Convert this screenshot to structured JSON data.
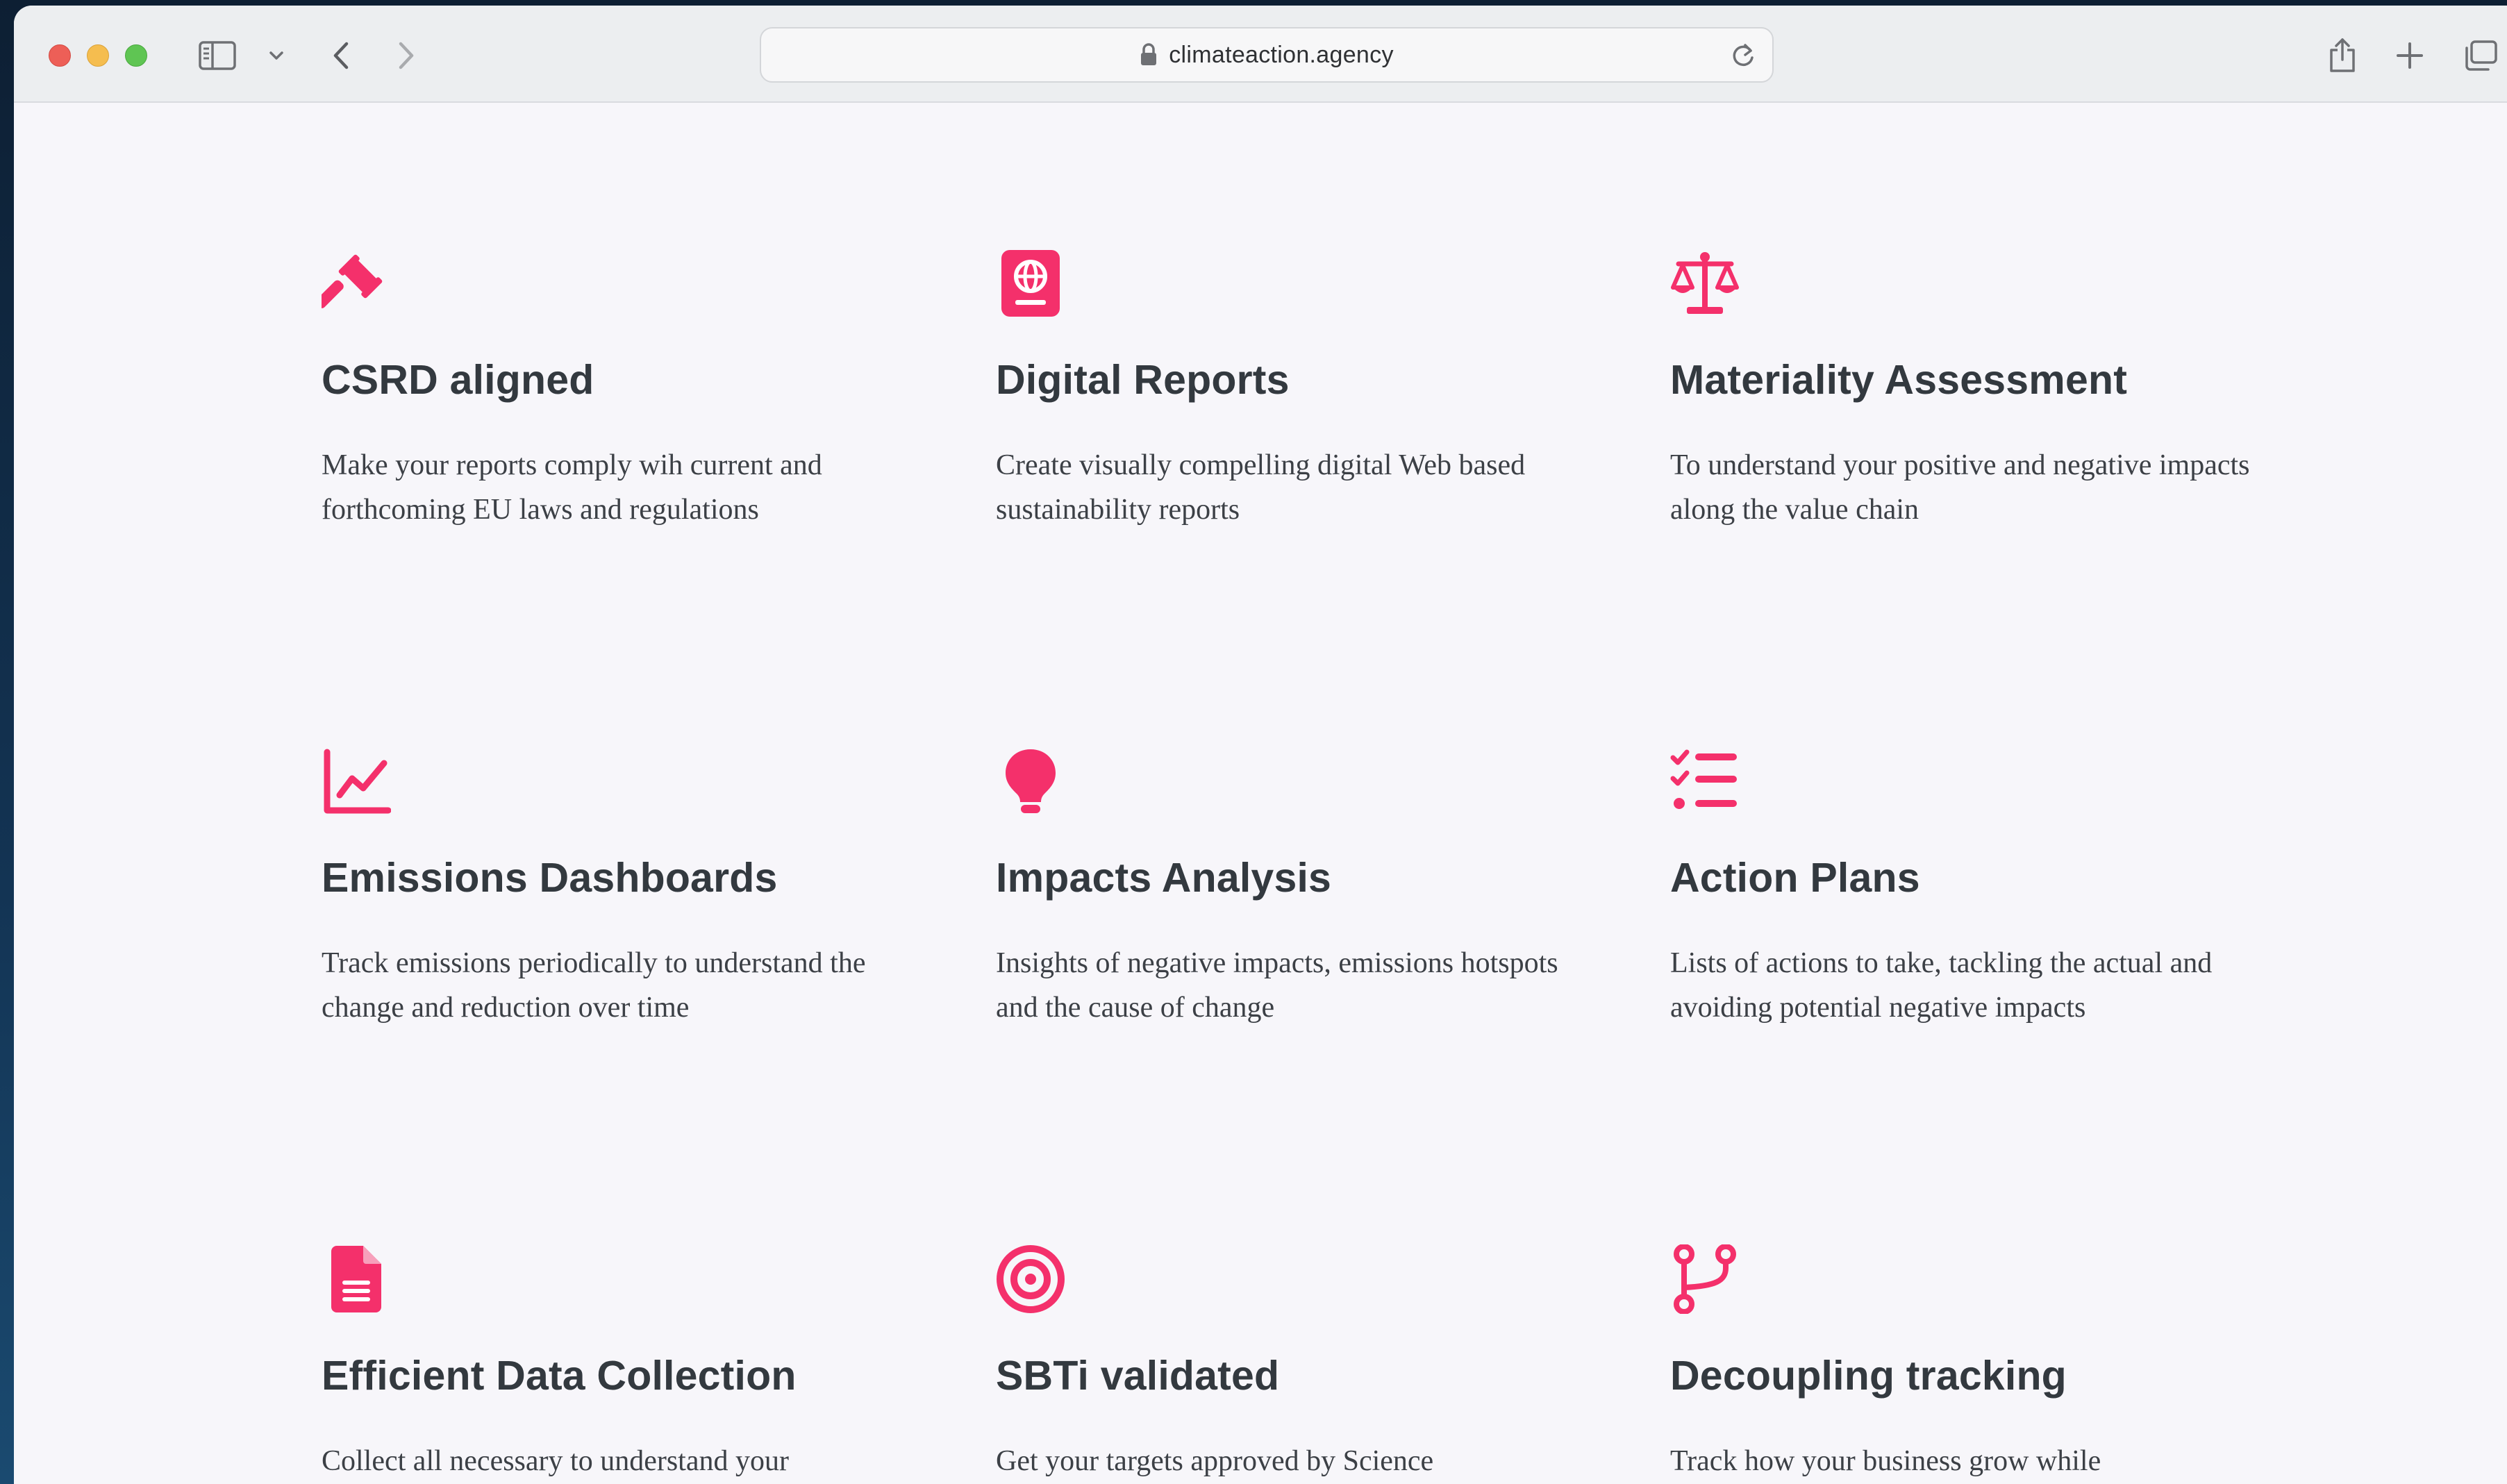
{
  "browser": {
    "url": "climateaction.agency",
    "icons": {
      "sidebar": "sidebar-icon",
      "back": "chevron-left-icon",
      "forward": "chevron-right-icon",
      "lock": "lock-icon",
      "reload": "reload-icon",
      "share": "share-icon",
      "new_tab": "plus-icon",
      "tabs": "tabs-overview-icon"
    }
  },
  "colors": {
    "accent": "#f4306b",
    "title": "#33393f",
    "text": "#3c4046",
    "page_bg": "#f7f6fa"
  },
  "features": [
    {
      "icon": "gavel-icon",
      "title": "CSRD aligned",
      "desc": "Make your reports comply wih current and forthcoming EU laws and regulations"
    },
    {
      "icon": "passport-globe-icon",
      "title": "Digital Reports",
      "desc": "Create visually compelling digital Web based sustainability reports"
    },
    {
      "icon": "scales-icon",
      "title": "Materiality Assessment",
      "desc": "To understand your positive and negative impacts along the value chain"
    },
    {
      "icon": "line-chart-icon",
      "title": "Emissions Dashboards",
      "desc": "Track emissions periodically to understand the change and reduction over time"
    },
    {
      "icon": "lightbulb-icon",
      "title": "Impacts Analysis",
      "desc": "Insights of negative impacts, emissions hotspots and the cause of change"
    },
    {
      "icon": "checklist-icon",
      "title": "Action Plans",
      "desc": "Lists of actions to take, tackling the actual and avoiding potential negative impacts"
    },
    {
      "icon": "document-icon",
      "title": "Efficient Data Collection",
      "desc": "Collect all necessary to understand your"
    },
    {
      "icon": "target-icon",
      "title": "SBTi validated",
      "desc": "Get your targets approved by Science"
    },
    {
      "icon": "branch-icon",
      "title": "Decoupling tracking",
      "desc": "Track how your business grow while"
    }
  ]
}
